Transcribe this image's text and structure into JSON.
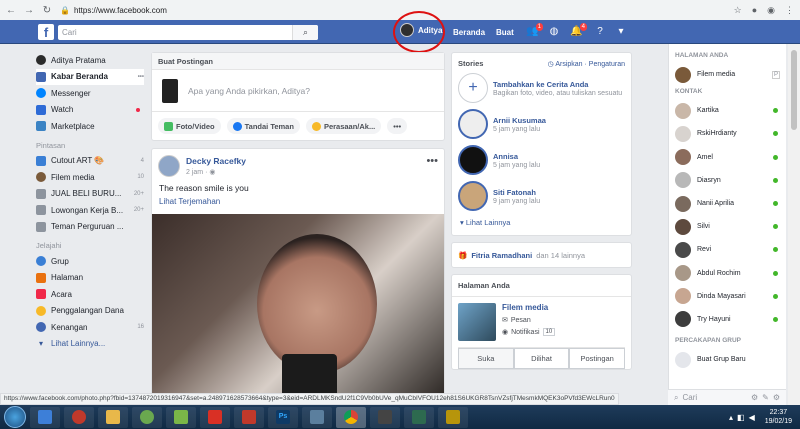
{
  "browser": {
    "url": "https://www.facebook.com",
    "secure_icon": "lock-icon"
  },
  "topbar": {
    "search_placeholder": "Cari",
    "user_name": "Aditya",
    "beranda": "Beranda",
    "buat": "Buat",
    "friend_badge": "1",
    "notif_badge": "4",
    "colors": {
      "bar": "#4267b2",
      "badge": "#fa3e3e"
    }
  },
  "left": {
    "profile": "Aditya Pratama",
    "items": [
      {
        "label": "Kabar Beranda",
        "more": "•••"
      },
      {
        "label": "Messenger"
      },
      {
        "label": "Watch"
      },
      {
        "label": "Marketplace"
      }
    ],
    "pintasan_title": "Pintasan",
    "shortcuts": [
      {
        "label": "Cutout ART 🎨",
        "count": "4"
      },
      {
        "label": "Filem media",
        "count": "10"
      },
      {
        "label": "JUAL BELI BURU...",
        "count": "20+"
      },
      {
        "label": "Lowongan Kerja B...",
        "count": "20+"
      },
      {
        "label": "Teman Perguruan ...",
        "count": ""
      }
    ],
    "jelajahi_title": "Jelajahi",
    "explore": [
      {
        "label": "Grup",
        "count": ""
      },
      {
        "label": "Halaman",
        "count": ""
      },
      {
        "label": "Acara",
        "count": ""
      },
      {
        "label": "Penggalangan Dana",
        "count": ""
      },
      {
        "label": "Kenangan",
        "count": "16"
      }
    ],
    "more": "Lihat Lainnya..."
  },
  "composer": {
    "title": "Buat Postingan",
    "prompt": "Apa yang Anda pikirkan, Aditya?",
    "actions": [
      "Foto/Video",
      "Tandai Teman",
      "Perasaan/Ak..."
    ],
    "more": "•••"
  },
  "post": {
    "author": "Decky Racefky",
    "time": "2 jam",
    "text": "The reason smile is you",
    "translate": "Lihat Terjemahan",
    "more": "•••"
  },
  "stories": {
    "title": "Stories",
    "archive": "Arsipkan",
    "settings": "Pengaturan",
    "add_title": "Tambahkan ke Cerita Anda",
    "add_sub": "Bagikan foto, video, atau tuliskan sesuatu",
    "items": [
      {
        "name": "Arnii Kusumaa",
        "time": "5 jam yang lalu"
      },
      {
        "name": "Annisa",
        "time": "5 jam yang lalu"
      },
      {
        "name": "Siti Fatonah",
        "time": "9 jam yang lalu"
      }
    ],
    "more": "Lihat Lainnya"
  },
  "birthday": {
    "name": "Fitria Ramadhani",
    "rest": "dan 14 lainnya"
  },
  "your_pages": {
    "title": "Halaman Anda",
    "page_name": "Filem media",
    "pesan": "Pesan",
    "notifikasi": "Notifikasi",
    "notif_count": "10",
    "tabs": [
      "Suka",
      "Dilihat",
      "Postingan"
    ]
  },
  "right": {
    "pages_title": "HALAMAN ANDA",
    "page": "Filem media",
    "page_badge": "P",
    "contacts_title": "KONTAK",
    "contacts": [
      "Kartika",
      "RskiHrdianty",
      "Amel",
      "Diasryn",
      "Nanii Aprilia",
      "Silvi",
      "Revi",
      "Abdul Rochim",
      "Dinda Mayasari",
      "Try Hayuni"
    ],
    "groups_title": "PERCAKAPAN GRUP",
    "new_group": "Buat Grup Baru",
    "search": "Cari",
    "online_color": "#42b72a"
  },
  "status_url": "https://www.facebook.com/photo.php?fbid=1374872019316947&set=a.248971628573664&type=3&eid=ARDLMKSndU2f1C9Vb0bUVe_qMuCbIVFOU12eh81S6UKGR8TsnVZsfjTMesmkMQEK3oPVfd3EWcLRun0",
  "taskbar": {
    "time": "22:37",
    "date": "19/02/19"
  }
}
